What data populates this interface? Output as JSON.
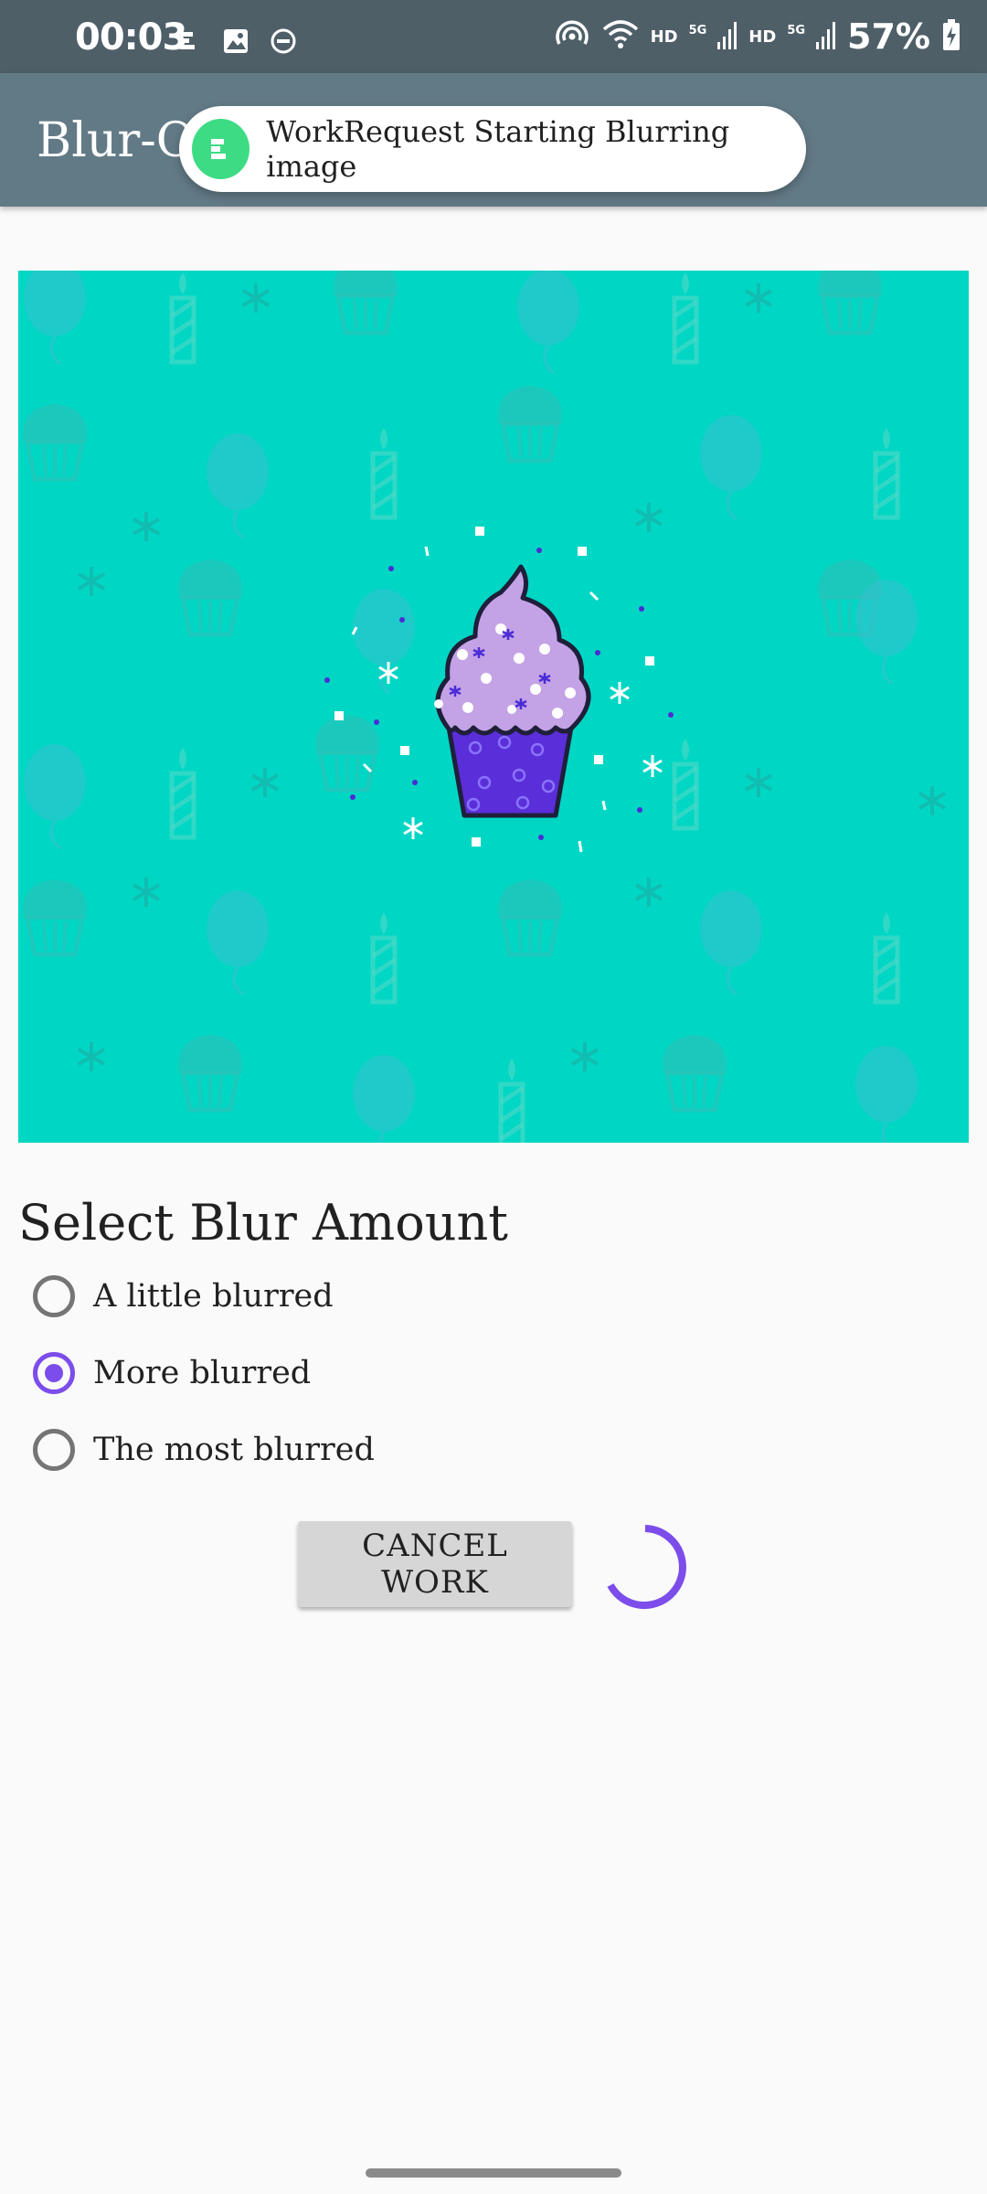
{
  "status_bar": {
    "time": "00:03",
    "network_labels": [
      "HD",
      "5G",
      "HD",
      "5G"
    ],
    "battery": "57%"
  },
  "app_bar": {
    "title": "Blur-O"
  },
  "toast": {
    "text": "WorkRequest Starting Blurring image"
  },
  "blur_options": {
    "title": "Select Blur Amount",
    "options": [
      {
        "label": "A little blurred",
        "selected": false
      },
      {
        "label": "More blurred",
        "selected": true
      },
      {
        "label": "The most blurred",
        "selected": false
      }
    ]
  },
  "actions": {
    "cancel_label": "CANCEL WORK"
  },
  "colors": {
    "status_bar": "#4f5f68",
    "app_bar": "#627a86",
    "accent": "#7c4dea",
    "image_background": "#00d6c4"
  }
}
